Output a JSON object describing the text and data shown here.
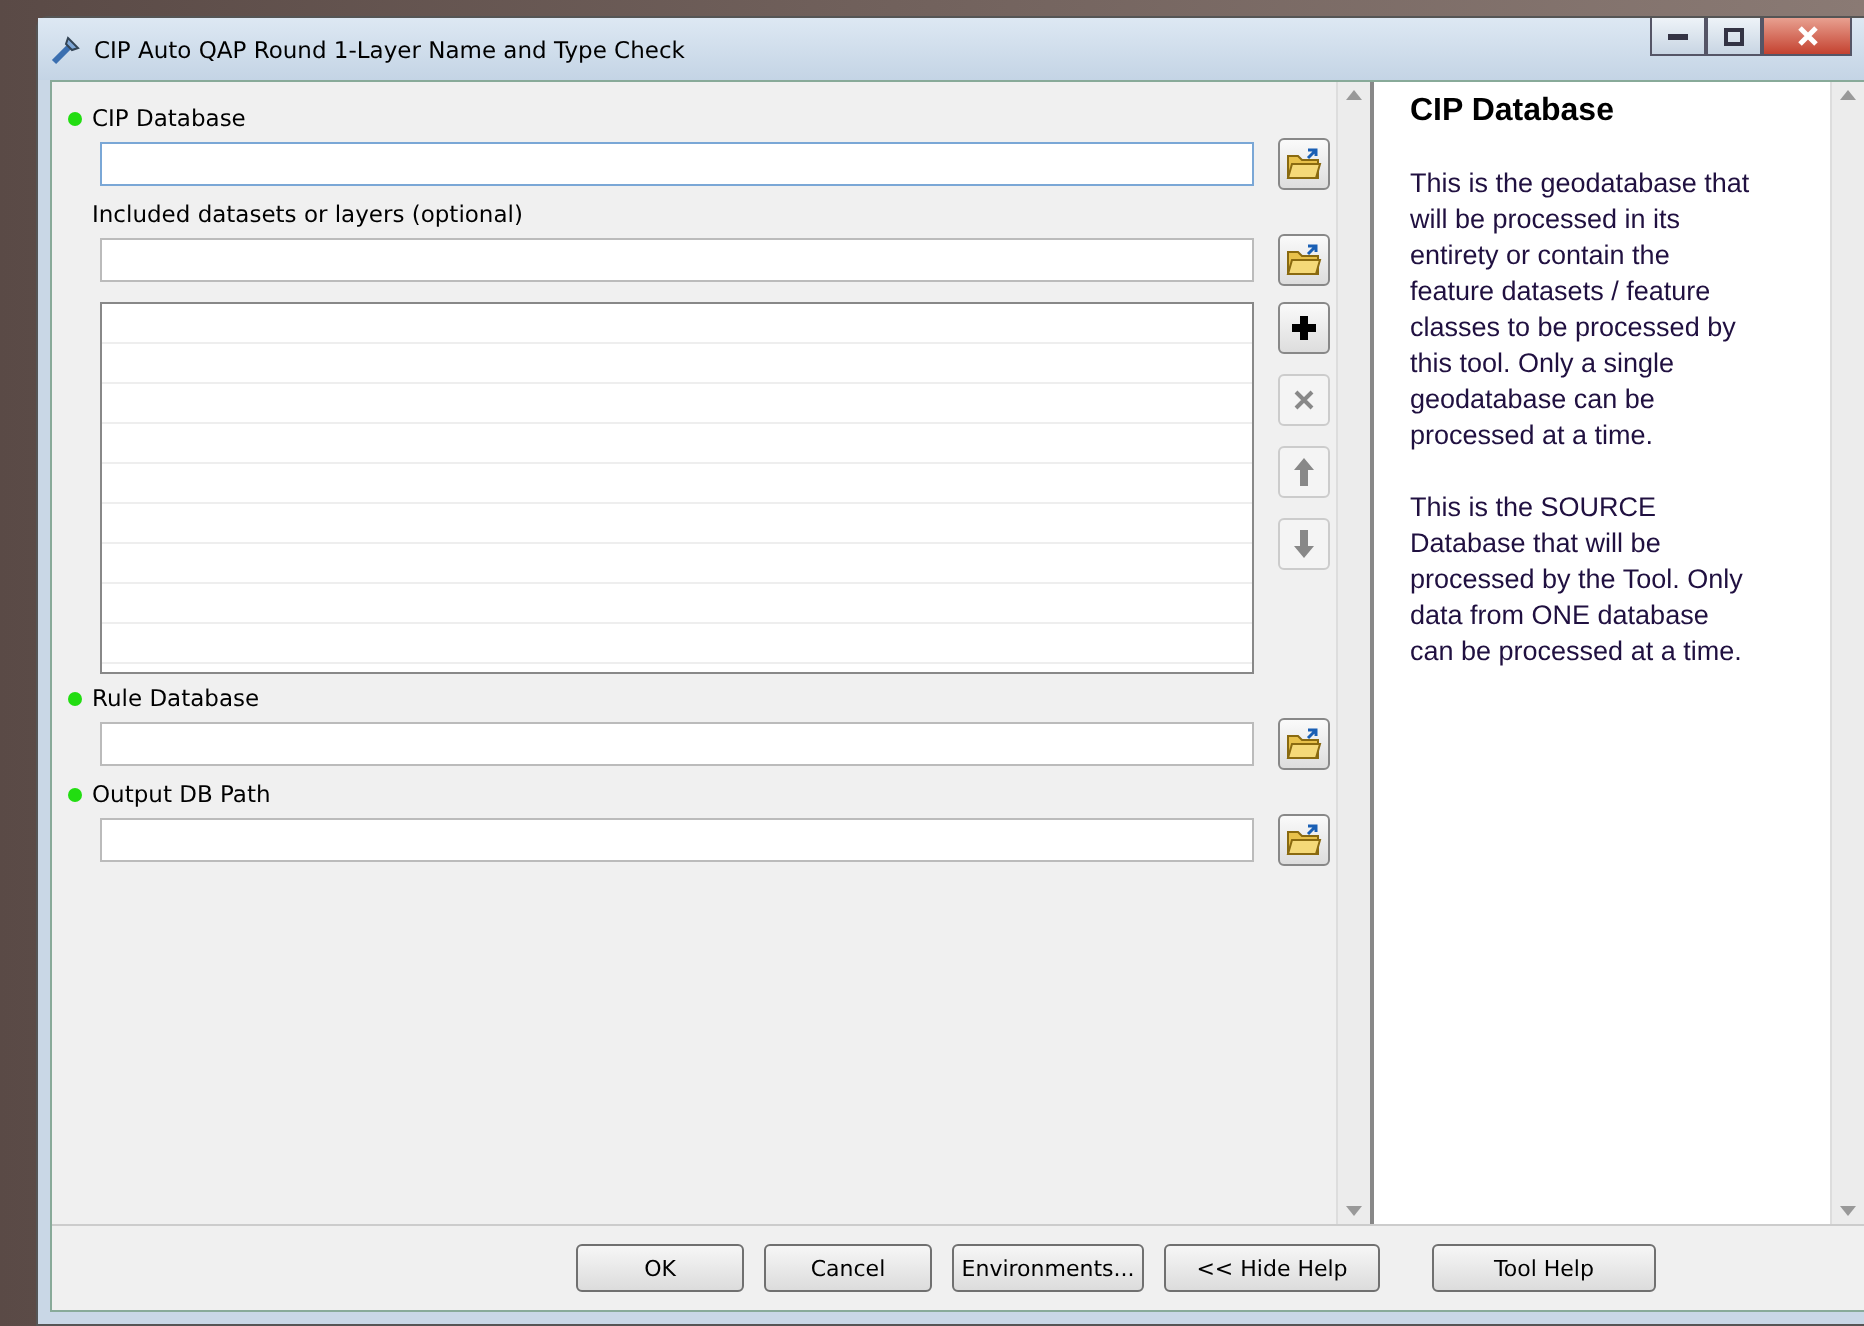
{
  "window": {
    "title": "CIP Auto QAP Round 1-Layer Name and Type Check"
  },
  "parameters": [
    {
      "kind": "field",
      "label": "CIP Database",
      "required": true,
      "focused": true
    },
    {
      "kind": "field",
      "label": "Included datasets or layers (optional)",
      "required": false,
      "focused": false
    },
    {
      "kind": "list",
      "disabled_tools": [
        false,
        true,
        true,
        true
      ]
    },
    {
      "kind": "field",
      "label": "Rule Database",
      "required": true,
      "focused": false
    },
    {
      "kind": "field",
      "label": "Output DB Path",
      "required": true,
      "focused": false
    }
  ],
  "help": {
    "title": "CIP Database",
    "paragraphs": [
      "This is the geodatabase that will be processed in its entirety or contain the feature datasets / feature classes to be processed by this tool. Only a single geodatabase can be processed at a time.",
      "This is the SOURCE Database that will be processed by the Tool. Only data from ONE database can be processed at a time."
    ]
  },
  "buttons": [
    "OK",
    "Cancel",
    "Environments...",
    "<< Hide Help",
    "Tool Help"
  ]
}
